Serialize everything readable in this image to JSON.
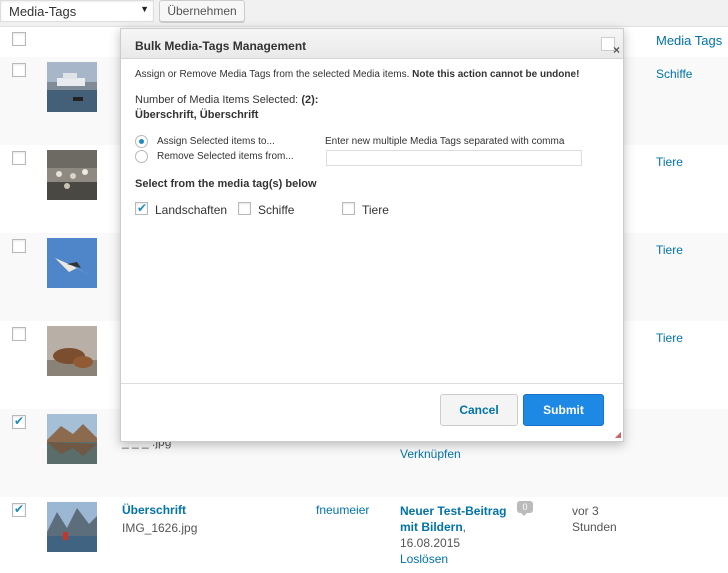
{
  "toolbar": {
    "bulk_select_value": "Media-Tags",
    "apply_label": "Übernehmen"
  },
  "table": {
    "column_media_tags": "Media Tags",
    "rows": [
      {
        "tags": "Schiffe",
        "checked": false
      },
      {
        "tags": "Tiere",
        "checked": false
      },
      {
        "tags": "Tiere",
        "checked": false
      },
      {
        "tags": "Tiere",
        "checked": false
      },
      {
        "title_fragment": "_ _ _ .jpg",
        "link_action": "Verknüpfen",
        "checked": true
      },
      {
        "title": "Überschrift",
        "file_name": "IMG_1626.jpg",
        "author": "fneumeier",
        "attached_post": "Neuer Test-Beitrag mit Bildern",
        "attached_date": ", 16.08.2015",
        "detach_label": "Loslösen",
        "comment_count": "0",
        "date_line1": "vor 3",
        "date_line2": "Stunden",
        "checked": true
      }
    ]
  },
  "modal": {
    "title": "Bulk Media-Tags Management",
    "close_label": "×",
    "intro_text": "Assign or Remove Media Tags from the selected Media items.",
    "intro_warning": "Note this action cannot be undone!",
    "count_label": "Number of Media Items Selected:",
    "count_value": "(2):",
    "selected_titles": "Überschrift, Überschrift",
    "assign_label": "Assign Selected items to...",
    "remove_label": "Remove Selected items from...",
    "new_tags_label": "Enter new multiple Media Tags separated with comma",
    "new_tags_value": "",
    "select_heading": "Select from the media tag(s) below",
    "tags": [
      {
        "label": "Landschaften",
        "checked": true
      },
      {
        "label": "Schiffe",
        "checked": false
      },
      {
        "label": "Tiere",
        "checked": false
      }
    ],
    "cancel_label": "Cancel",
    "submit_label": "Submit"
  },
  "colors": {
    "link": "#0073aa",
    "submit": "#1e88e5",
    "check": "#1e8cbe"
  }
}
